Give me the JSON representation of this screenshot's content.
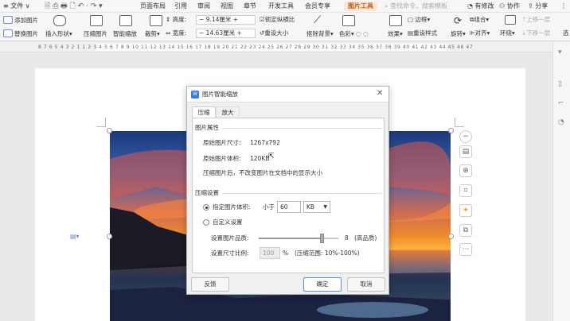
{
  "menubar": {
    "file": "文件",
    "items": [
      "页面布局",
      "引用",
      "审阅",
      "视图",
      "章节",
      "开发工具",
      "会员专享",
      "图片工具"
    ],
    "search_placeholder": "查找命令、搜索模板",
    "status_items": [
      "有修改",
      "协作",
      "分享"
    ]
  },
  "ribbon": {
    "add_image": "添加图片",
    "replace_image": "替换图片",
    "insert_shape": "插入形状",
    "compress_image": "压缩图片",
    "smart_zoom": "智能缩放",
    "crop": "裁剪",
    "height_label": "高度:",
    "height_value": "9.14厘米",
    "width_label": "宽度:",
    "width_value": "14.63厘米",
    "lock_ratio": "锁定纵横比",
    "reset_size": "重设大小",
    "remove_bg": "抠除背景",
    "color": "色彩",
    "effect": "效果",
    "border": "边框",
    "reset_style": "重设样式",
    "combine": "组合",
    "rotate": "旋转",
    "align": "对齐",
    "wrap": "环绕",
    "move_up": "上移一层",
    "move_down": "下移一层",
    "select": "选"
  },
  "ruler": {
    "text": "8 7 6 5 4 3 2 1   1 2 3 4 5 6 7 8 9 10 11 12 13 14 15 16 17 18 19 20 21 22 23 24 25 26 27 28 29 30 31 32 33 34 35 36 37 38 39 40 41 42 43 44 45 46 47"
  },
  "dialog": {
    "title": "图片智能缩放",
    "tabs": [
      "压缩",
      "放大"
    ],
    "section_props": "图片属性",
    "orig_size_label": "原始图片尺寸:",
    "orig_size_value": "1267x792",
    "orig_volume_label": "原始图片体积:",
    "orig_volume_value": "120KB",
    "note": "压缩图片后，不改变图片在文档中的显示大小",
    "section_compress": "压缩设置",
    "opt_volume": "指定图片体积:",
    "less_than": "小于",
    "volume_value": "60",
    "unit": "KB",
    "opt_custom": "自定义设置",
    "quality_label": "设置图片品质:",
    "quality_value": "8",
    "quality_level": "(高品质)",
    "quality_fraction": 0.8,
    "ratio_label": "设置尺寸比例:",
    "ratio_value": "100",
    "ratio_unit": "%",
    "ratio_range": "(压缩范围: 10%-100%)",
    "feedback": "反馈",
    "ok": "确定",
    "cancel": "取消"
  },
  "colors": {
    "accent": "#c55a11",
    "dialog_bg": "#f0f0f0",
    "primary_border": "#5b8de0"
  }
}
